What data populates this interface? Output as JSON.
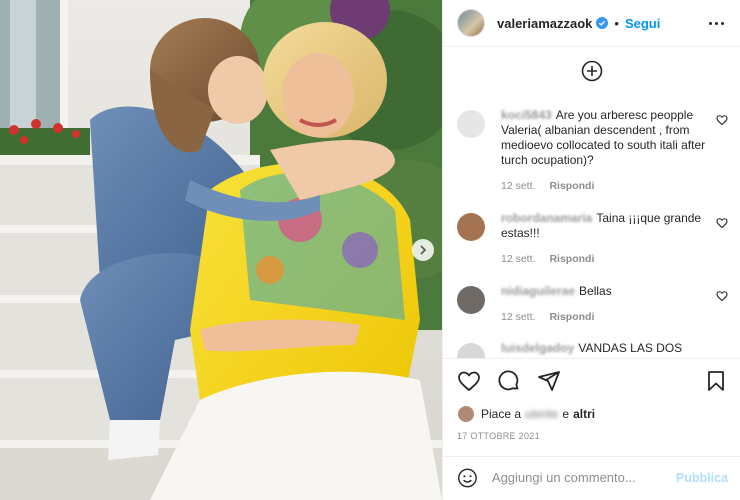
{
  "post": {
    "username": "valeriamazzaok",
    "follow_label": "Segui",
    "date": "17 OTTOBRE 2021",
    "likes": {
      "prefix": "Piace a",
      "blurred_user": "utente",
      "mid": "e",
      "suffix": "altri"
    }
  },
  "comments": [
    {
      "username": "koci5843",
      "text": "Are you arberesc peopple Valeria( albanian descendent , from medioevo collocated to south itali after turch ocupation)?",
      "age": "12 sett.",
      "reply_label": "Rispondi",
      "avatar_color": "#e6e6e6"
    },
    {
      "username": "robordanamaria",
      "text": "Taina ¡¡¡que grande estas!!!",
      "age": "12 sett.",
      "reply_label": "Rispondi",
      "avatar_color": "#a47452"
    },
    {
      "username": "nidiaguilerae",
      "text": "Bellas",
      "age": "12 sett.",
      "reply_label": "Rispondi",
      "avatar_color": "#6f6a66"
    },
    {
      "username": "luisdelgadoy",
      "text": "VANDAS LAS DOS",
      "age": "",
      "reply_label": "",
      "avatar_color": "#d8d8d8"
    }
  ],
  "composer": {
    "placeholder": "Aggiungi un commento...",
    "publish_label": "Pubblica"
  },
  "colors": {
    "accent": "#0095f6",
    "publish_disabled": "#b2dffc",
    "verified": "#3897f0"
  },
  "icons": [
    "verified-badge-icon",
    "more-options-icon",
    "add-comment-plus-icon",
    "heart-icon",
    "comment-icon",
    "share-icon",
    "bookmark-icon",
    "emoji-icon",
    "carousel-next-icon"
  ]
}
